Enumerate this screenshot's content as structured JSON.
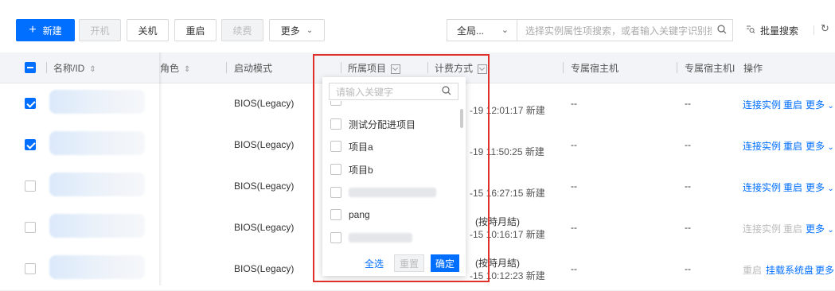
{
  "toolbar": {
    "new_label": "新建",
    "power_on_label": "开机",
    "power_off_label": "关机",
    "restart_label": "重启",
    "renew_label": "续费",
    "more_label": "更多",
    "scope_value": "全局...",
    "search_placeholder": "选择实例属性项搜索，或者输入关键字识别搜索",
    "batch_search_label": "批量搜索"
  },
  "table": {
    "headers": {
      "name_id": "名称/ID",
      "role": "角色",
      "boot_mode": "启动模式",
      "project": "所属项目",
      "billing": "计费方式",
      "dedicated_host": "专属宿主机",
      "dedicated_host_id": "专属宿主机I",
      "actions": "操作"
    },
    "rows": [
      {
        "checked": true,
        "boot_mode": "BIOS(Legacy)",
        "billing_line1": "",
        "billing_line2": "-19 12:01:17 新建",
        "host": "--",
        "host_id": "--",
        "actions": [
          "连接实例",
          "重启",
          "更多"
        ]
      },
      {
        "checked": true,
        "boot_mode": "BIOS(Legacy)",
        "billing_line1": "",
        "billing_line2": "-19 11:50:25 新建",
        "host": "--",
        "host_id": "--",
        "actions": [
          "连接实例",
          "重启",
          "更多"
        ]
      },
      {
        "checked": false,
        "boot_mode": "BIOS(Legacy)",
        "billing_line1": "",
        "billing_line2": "-15 16:27:15 新建",
        "host": "--",
        "host_id": "--",
        "actions": [
          "连接实例",
          "重启",
          "更多"
        ]
      },
      {
        "checked": false,
        "boot_mode": "BIOS(Legacy)",
        "billing_line1": "(按時月結)",
        "billing_line2": "-15 10:16:17 新建",
        "host": "--",
        "host_id": "--",
        "actions": [
          "连接实例",
          "重启",
          "更多"
        ]
      },
      {
        "checked": false,
        "boot_mode": "BIOS(Legacy)",
        "billing_line1": "(按時月結)",
        "billing_line2": "-15 10:12:23 新建",
        "host": "--",
        "host_id": "--",
        "actions": [
          "重启",
          "挂载系统盘",
          "更多"
        ]
      }
    ]
  },
  "dropdown": {
    "search_placeholder": "请输入关键字",
    "options": [
      "测试分配进项目",
      "项目a",
      "项目b",
      "",
      "pang",
      ""
    ],
    "select_all_label": "全选",
    "reset_label": "重置",
    "confirm_label": "确定"
  },
  "colors": {
    "primary": "#006eff",
    "highlight_border": "#e0302a"
  }
}
